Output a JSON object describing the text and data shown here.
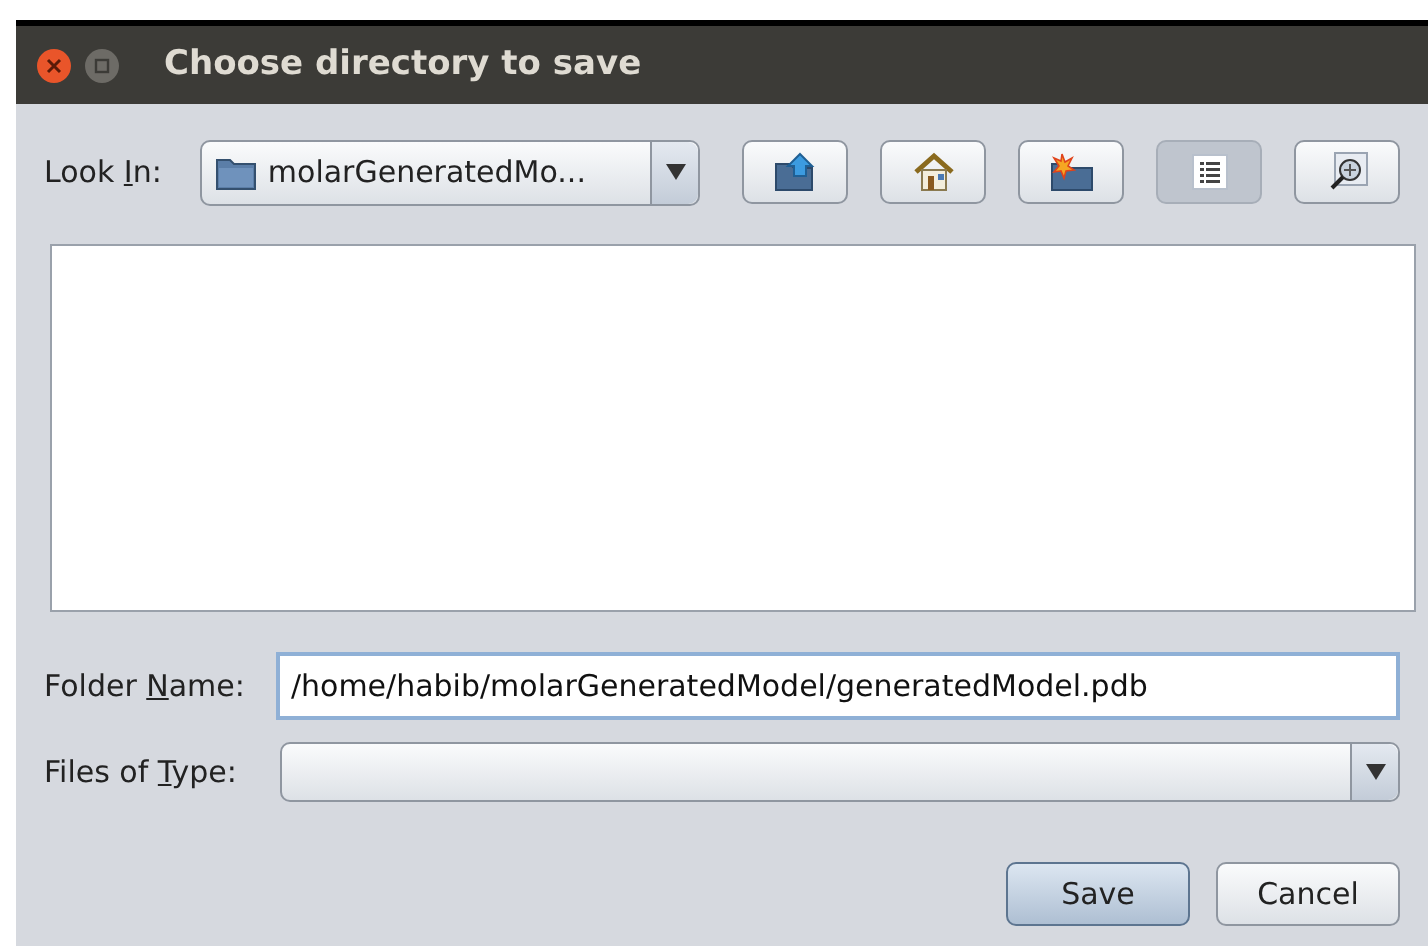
{
  "window": {
    "title": "Choose directory to save"
  },
  "look_in": {
    "label_parts": [
      "Look ",
      "I",
      "n:"
    ],
    "value": "molarGeneratedMo..."
  },
  "toolbar": [
    {
      "kind": "up",
      "selected": false
    },
    {
      "kind": "home",
      "selected": false
    },
    {
      "kind": "new-folder",
      "selected": false
    },
    {
      "kind": "list",
      "selected": true
    },
    {
      "kind": "details",
      "selected": false
    }
  ],
  "folder_name": {
    "label_parts": [
      "Folder ",
      "N",
      "ame:"
    ],
    "value": "/home/habib/molarGeneratedModel/generatedModel.pdb"
  },
  "files_of_type": {
    "label_parts": [
      "Files of ",
      "T",
      "ype:"
    ]
  },
  "buttons": [
    {
      "label": "Save",
      "default": true
    },
    {
      "label": "Cancel",
      "default": false
    }
  ]
}
